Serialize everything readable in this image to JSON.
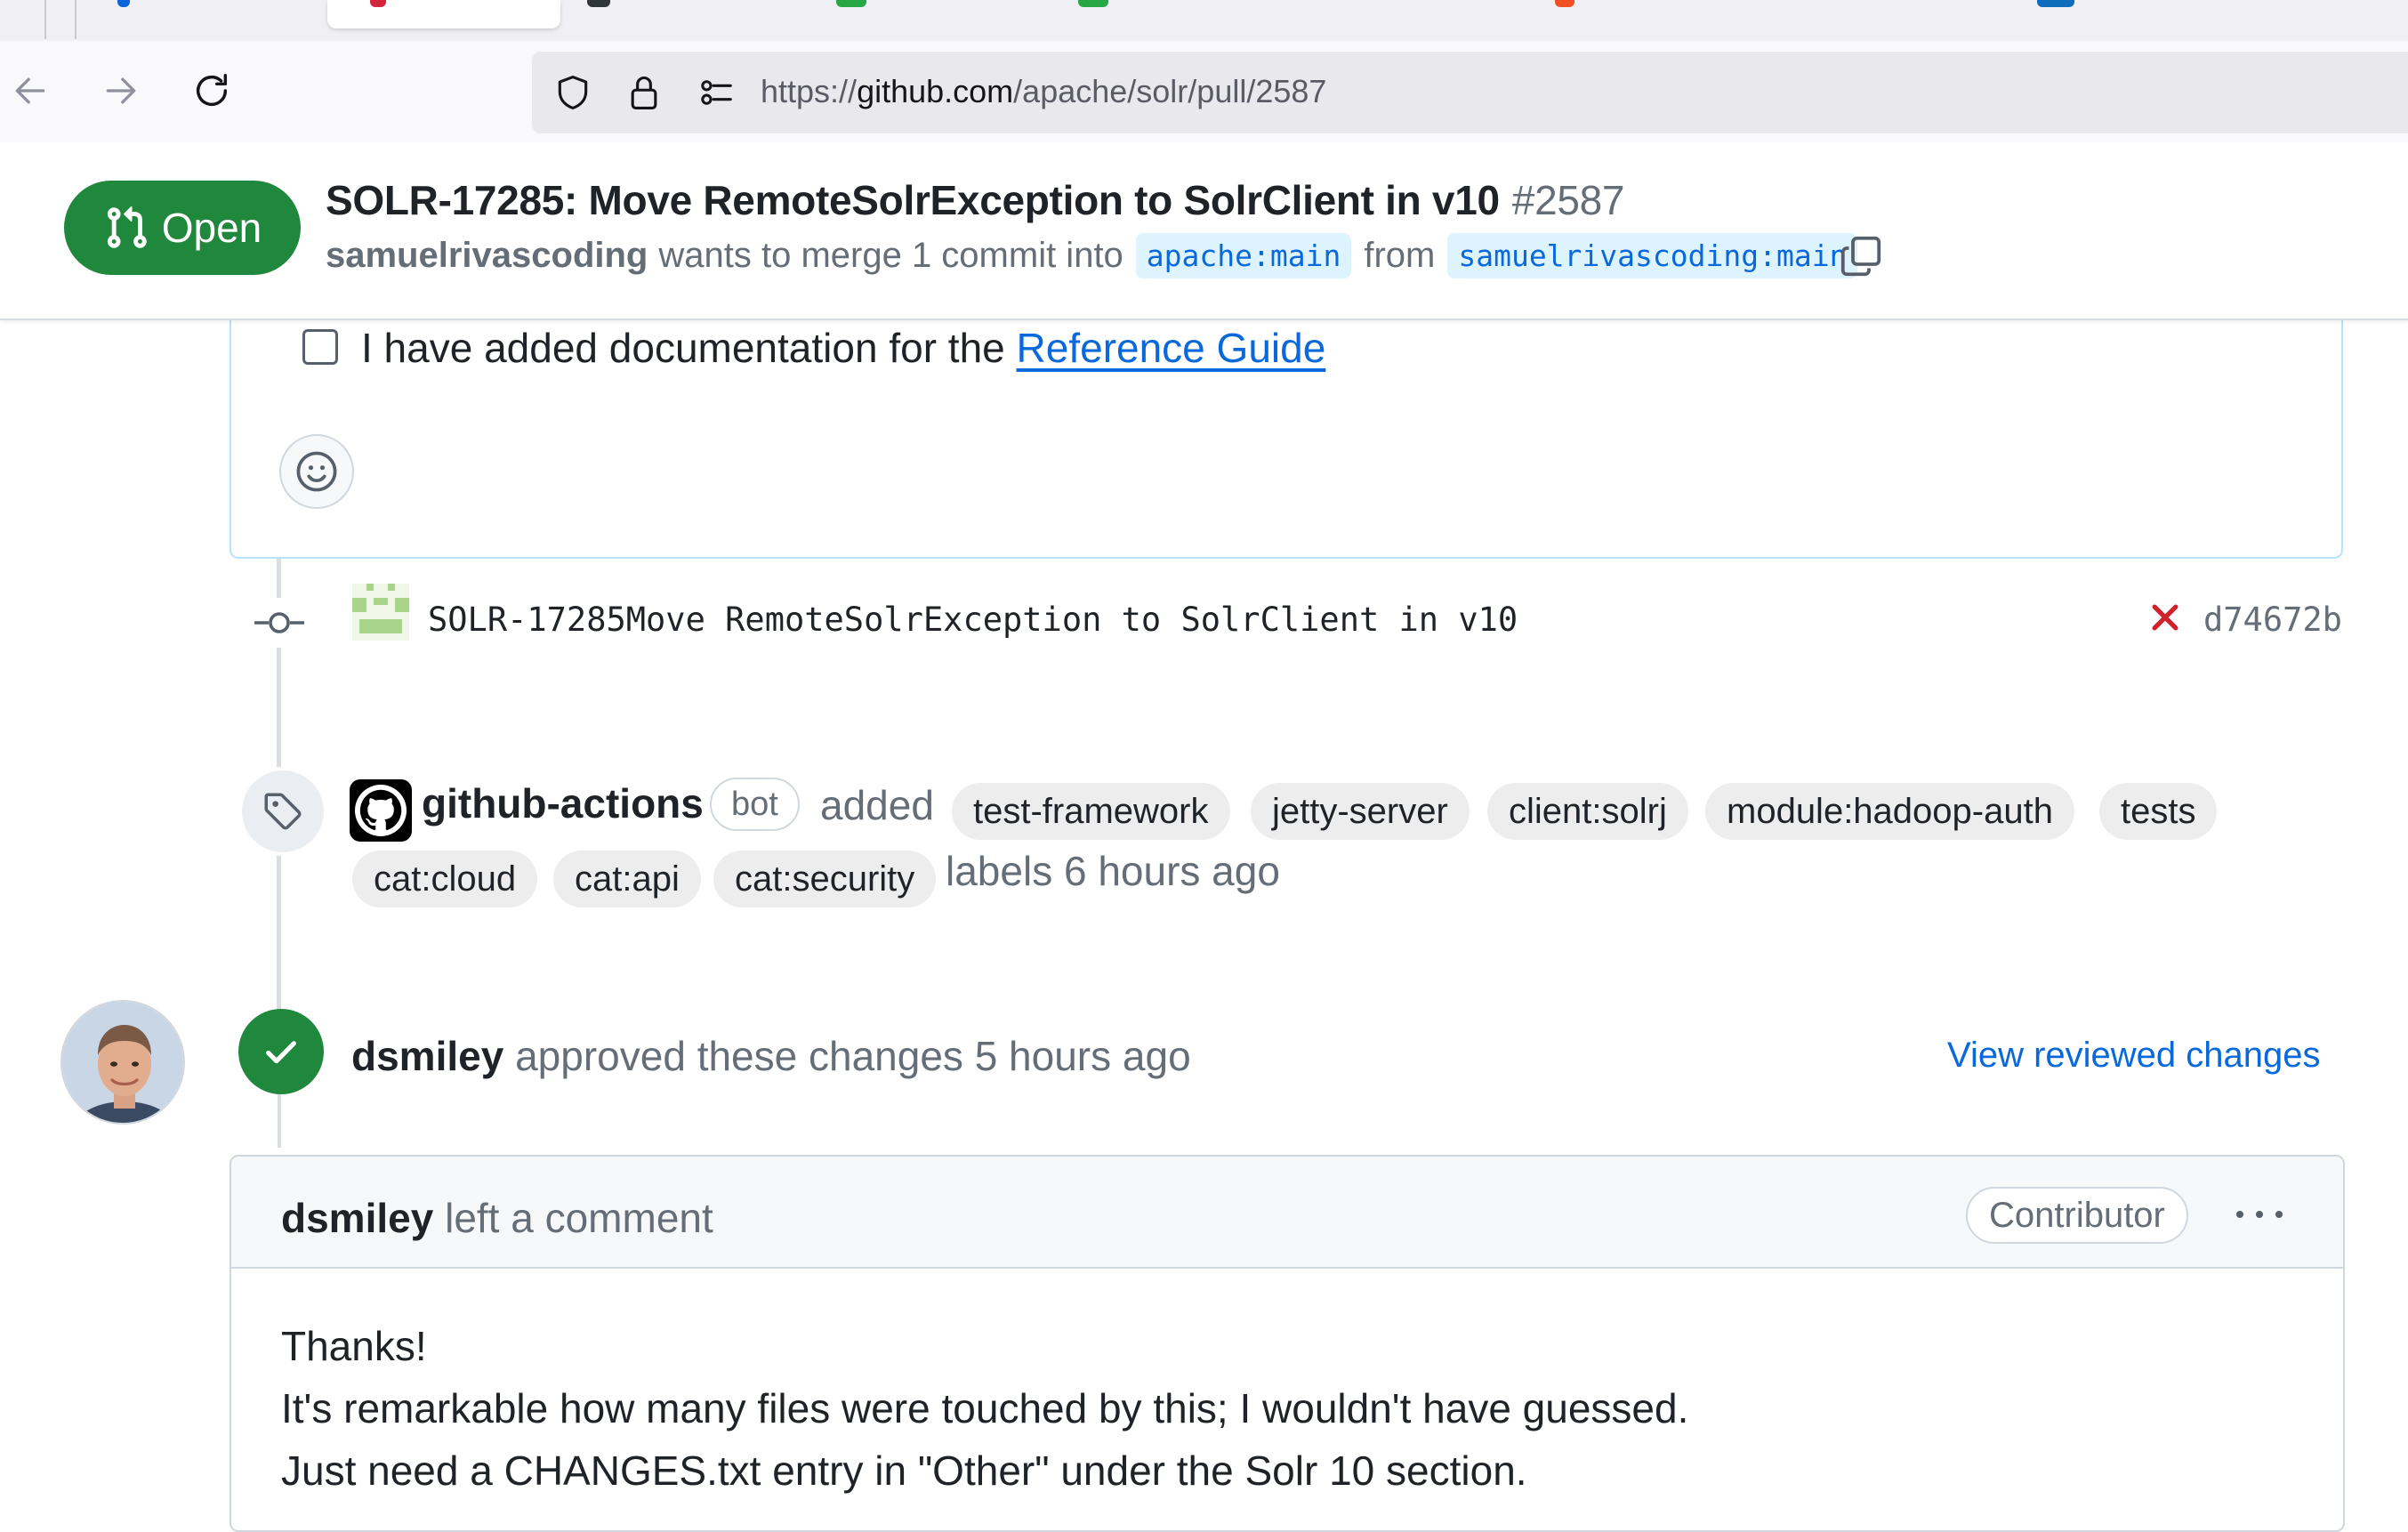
{
  "browser": {
    "url_scheme": "https://",
    "url_host": "github.com",
    "url_path": "/apache/solr/pull/2587"
  },
  "pr": {
    "state": "Open",
    "title": "SOLR-17285: Move RemoteSolrException to SolrClient in v10",
    "number": "#2587",
    "author": "samuelrivascoding",
    "merge_text": "wants to merge 1 commit into",
    "base_branch": "apache:main",
    "from_word": "from",
    "head_branch": "samuelrivascoding:main"
  },
  "description": {
    "task_text": "I have added documentation for the",
    "task_link": "Reference Guide"
  },
  "commit": {
    "message": "SOLR-17285Move RemoteSolrException to SolrClient in v10",
    "sha": "d74672b",
    "status": "failed"
  },
  "labels_event": {
    "actor": "github-actions",
    "badge": "bot",
    "verb": "added",
    "labels": [
      "test-framework",
      "jetty-server",
      "client:solrj",
      "module:hadoop-auth",
      "tests",
      "cat:cloud",
      "cat:api",
      "cat:security"
    ],
    "time_text": "labels 6 hours ago"
  },
  "review_event": {
    "actor": "dsmiley",
    "text": "approved these changes 5 hours ago",
    "link": "View reviewed changes"
  },
  "comment": {
    "actor": "dsmiley",
    "header_text": "left a comment",
    "badge": "Contributor",
    "lines": [
      "Thanks!",
      "It's remarkable how many files were touched by this; I wouldn't have guessed.",
      "Just need a CHANGES.txt entry in \"Other\" under the Solr 10 section."
    ]
  },
  "colors": {
    "open_green": "#1f883d",
    "link_blue": "#0969da",
    "fail_red": "#cf222e"
  }
}
